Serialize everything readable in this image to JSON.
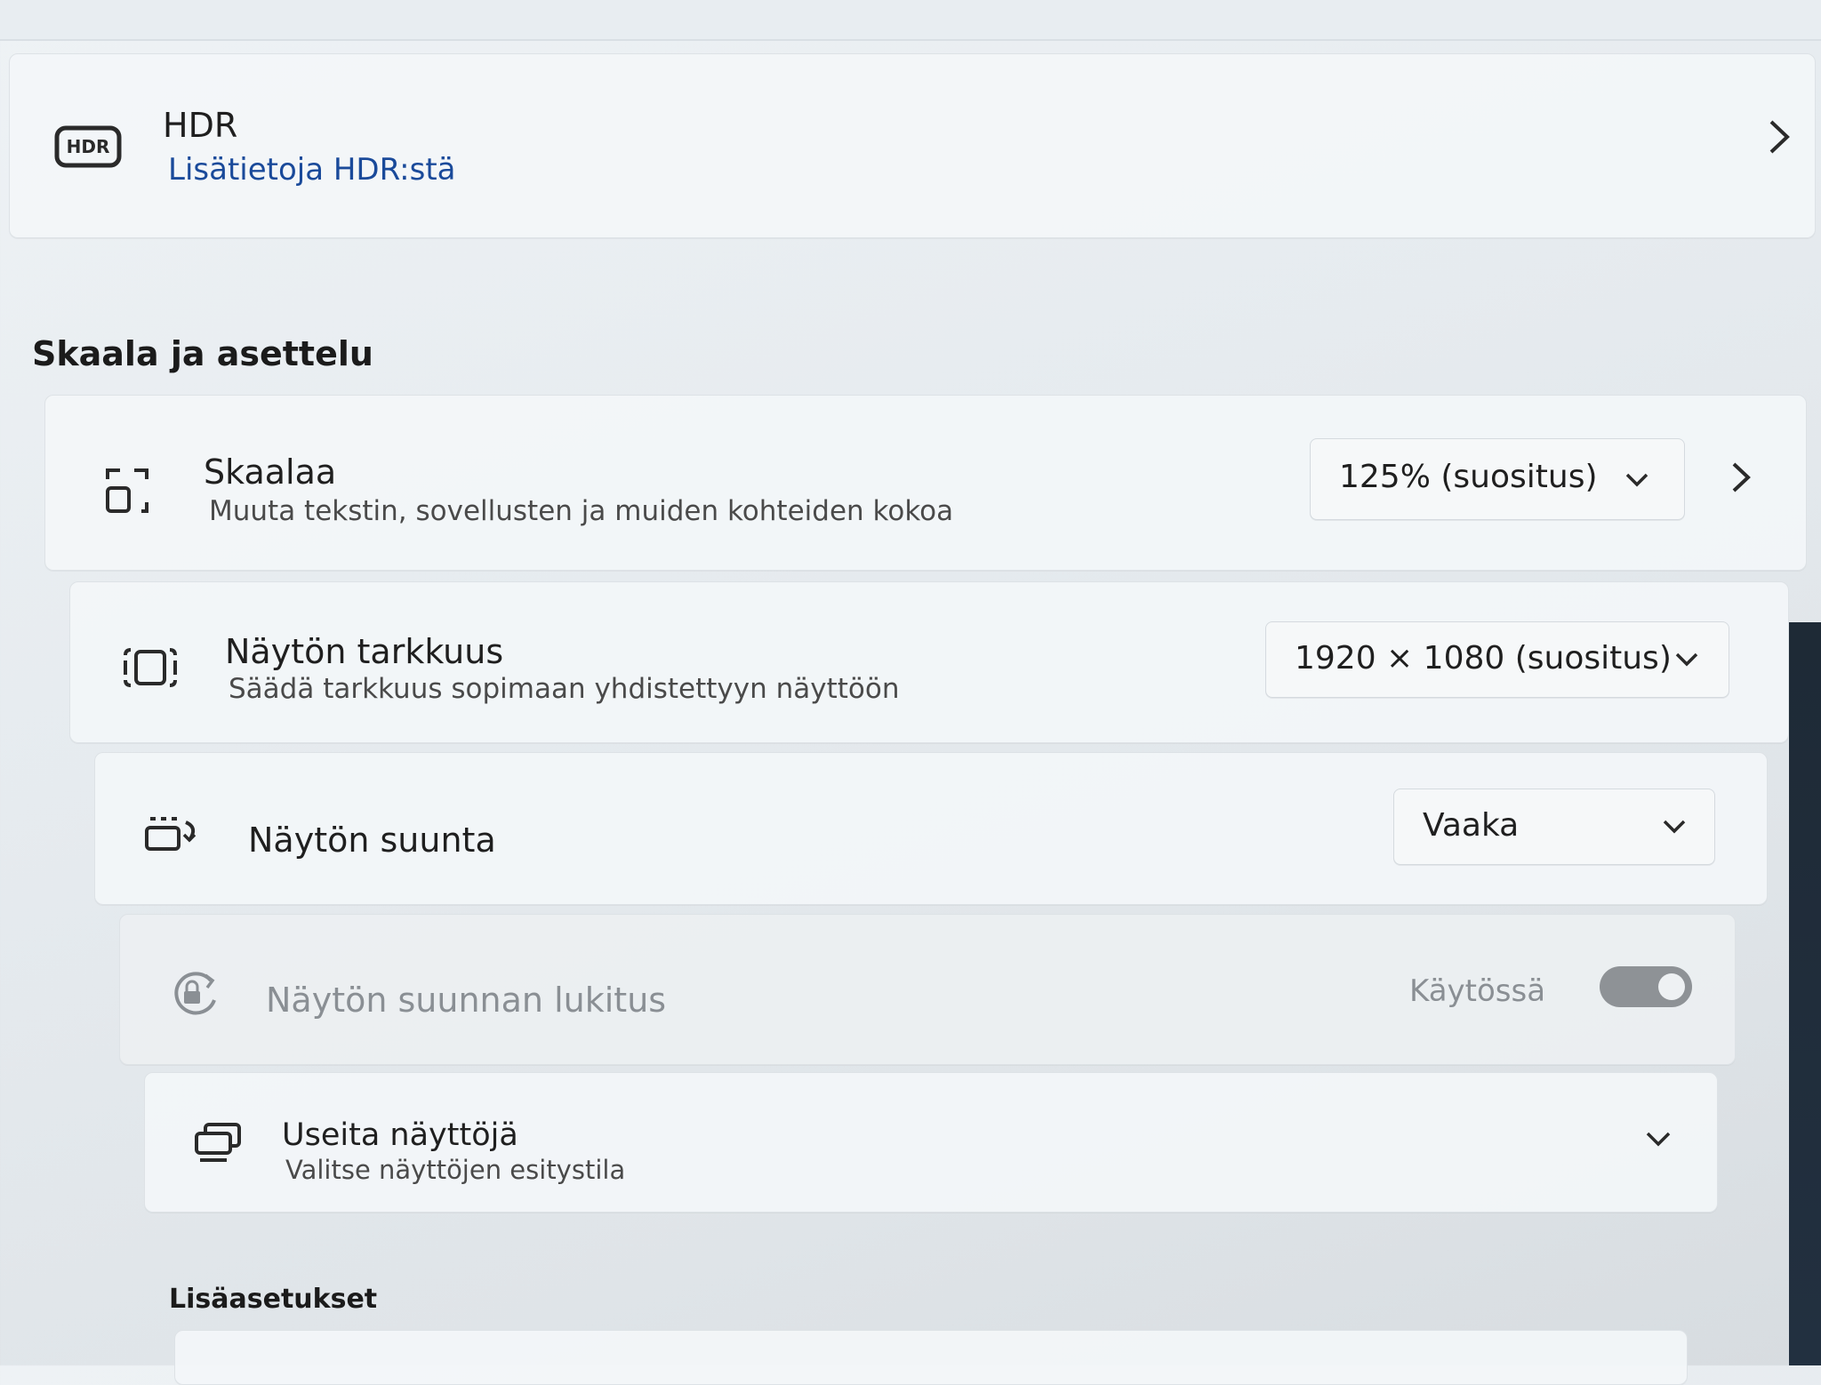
{
  "hdr": {
    "title": "HDR",
    "link": "Lisätietoja HDR:stä",
    "icon_label": "HDR"
  },
  "section": {
    "scale_layout": "Skaala ja asettelu",
    "advanced": "Lisäasetukset"
  },
  "scale": {
    "title": "Skaalaa",
    "subtitle": "Muuta tekstin, sovellusten ja muiden kohteiden kokoa",
    "value": "125% (suositus)"
  },
  "resolution": {
    "title": "Näytön tarkkuus",
    "subtitle": "Säädä tarkkuus sopimaan yhdistettyyn näyttöön",
    "value": "1920 × 1080 (suositus)"
  },
  "orientation": {
    "title": "Näytön suunta",
    "value": "Vaaka"
  },
  "rotation_lock": {
    "title": "Näytön suunnan lukitus",
    "state_label": "Käytössä"
  },
  "multiple_displays": {
    "title": "Useita näyttöjä",
    "subtitle": "Valitse näyttöjen esitystila"
  },
  "colors": {
    "link": "#1a4a9a",
    "toggle_disabled": "#8e9296"
  }
}
